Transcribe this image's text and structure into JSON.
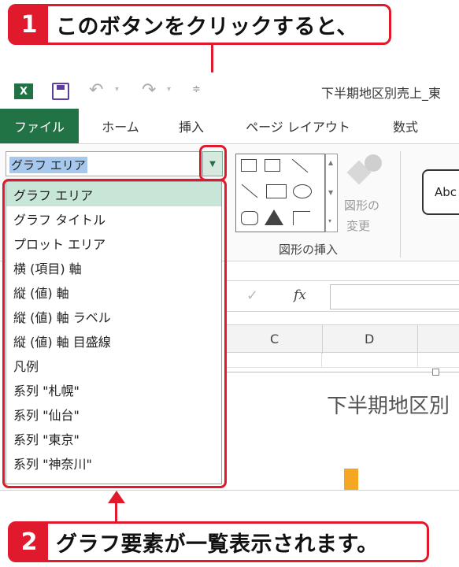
{
  "callout_top": {
    "number": "1",
    "text": "このボタンをクリックすると、"
  },
  "callout_bottom": {
    "number": "2",
    "text": "グラフ要素が一覧表示されます。"
  },
  "title_bar": {
    "filename": "下半期地区別売上_東"
  },
  "tabs": [
    "ファイル",
    "ホーム",
    "挿入",
    "ページ レイアウト",
    "数式"
  ],
  "chart_element_selector": {
    "value": "グラフ エリア"
  },
  "dropdown_items": [
    "グラフ エリア",
    "グラフ タイトル",
    "プロット エリア",
    "横 (項目) 軸",
    "縦 (値) 軸",
    "縦 (値) 軸 ラベル",
    "縦 (値) 軸 目盛線",
    "凡例",
    "系列 \"札幌\"",
    "系列 \"仙台\"",
    "系列 \"東京\"",
    "系列 \"神奈川\""
  ],
  "ribbon": {
    "change_shape_line1": "図形の",
    "change_shape_line2": "変更",
    "group_label": "図形の挿入",
    "style_sample": "Abc"
  },
  "formula_bar": {
    "fx": "fx"
  },
  "columns": [
    "C",
    "D"
  ],
  "chart_title": "下半期地区別",
  "colors": {
    "accent_red": "#e01a2c",
    "excel_green": "#217346",
    "selection": "#c8e6d8",
    "bar_orange": "#f5a623"
  }
}
